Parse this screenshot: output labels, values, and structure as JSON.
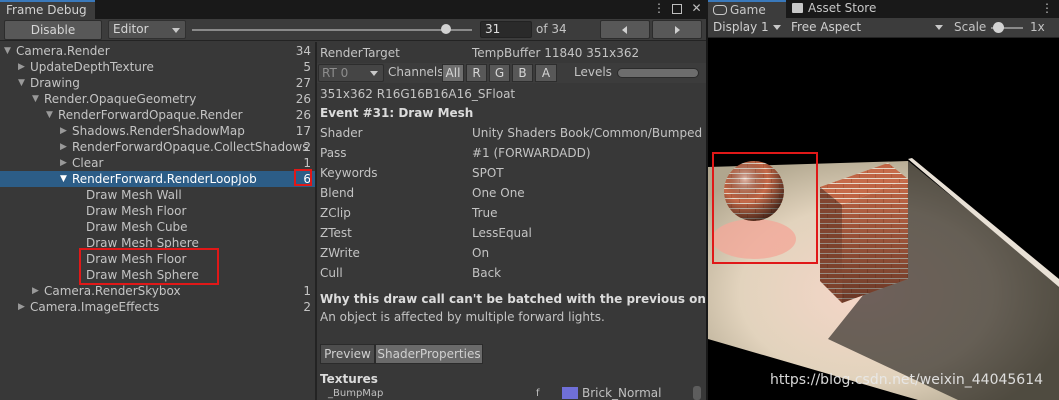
{
  "frame_debug": {
    "tab_title": "Frame Debug",
    "disable_label": "Disable",
    "source_select": "Editor",
    "event_number": "31",
    "event_total": "of 34",
    "event_progress": 31
  },
  "tree": [
    {
      "label": "Camera.Render",
      "count": "34",
      "arrow": "▼"
    },
    {
      "label": "UpdateDepthTexture",
      "count": "5",
      "arrow": "▶"
    },
    {
      "label": "Drawing",
      "count": "27",
      "arrow": "▼"
    },
    {
      "label": "Render.OpaqueGeometry",
      "count": "26",
      "arrow": "▼"
    },
    {
      "label": "RenderForwardOpaque.Render",
      "count": "26",
      "arrow": "▼"
    },
    {
      "label": "Shadows.RenderShadowMap",
      "count": "17",
      "arrow": "▶"
    },
    {
      "label": "RenderForwardOpaque.CollectShadows",
      "count": "2",
      "arrow": "▶"
    },
    {
      "label": "Clear",
      "count": "1",
      "arrow": "▶"
    },
    {
      "label": "RenderForward.RenderLoopJob",
      "count": "6",
      "arrow": "▼"
    },
    {
      "label": "Draw Mesh Wall",
      "count": "",
      "arrow": ""
    },
    {
      "label": "Draw Mesh Floor",
      "count": "",
      "arrow": ""
    },
    {
      "label": "Draw Mesh Cube",
      "count": "",
      "arrow": ""
    },
    {
      "label": "Draw Mesh Sphere",
      "count": "",
      "arrow": ""
    },
    {
      "label": "Draw Mesh Floor",
      "count": "",
      "arrow": ""
    },
    {
      "label": "Draw Mesh Sphere",
      "count": "",
      "arrow": ""
    },
    {
      "label": "Camera.RenderSkybox",
      "count": "1",
      "arrow": "▶"
    },
    {
      "label": "Camera.ImageEffects",
      "count": "2",
      "arrow": "▶"
    }
  ],
  "detail": {
    "render_target_label": "RenderTarget",
    "render_target_value": "TempBuffer 11840 351x362",
    "rt_select": "RT 0",
    "channels_label": "Channels",
    "channels": [
      "All",
      "R",
      "G",
      "B",
      "A"
    ],
    "levels_label": "Levels",
    "format": "351x362 R16G16B16A16_SFloat",
    "event_title": "Event #31: Draw Mesh",
    "props": [
      {
        "k": "Shader",
        "v": "Unity Shaders Book/Common/Bumped Sp"
      },
      {
        "k": "Pass",
        "v": "#1 (FORWARDADD)"
      },
      {
        "k": "Keywords",
        "v": "SPOT"
      },
      {
        "k": "Blend",
        "v": "One One"
      },
      {
        "k": "ZClip",
        "v": "True"
      },
      {
        "k": "ZTest",
        "v": "LessEqual"
      },
      {
        "k": "ZWrite",
        "v": "On"
      },
      {
        "k": "Cull",
        "v": "Back"
      }
    ],
    "batch_title": "Why this draw call can't be batched with the previous one",
    "batch_reason": "An object is affected by multiple forward lights.",
    "subtabs": [
      "Preview",
      "ShaderProperties"
    ],
    "textures_heading": "Textures",
    "texture_name": "_BumpMap",
    "texture_stage": "f",
    "texture_value": "Brick_Normal"
  },
  "game": {
    "tab_game": "Game",
    "tab_store": "Asset Store",
    "display": "Display 1",
    "aspect": "Free Aspect",
    "scale_label": "Scale",
    "scale_value": "1x"
  },
  "watermark": "https://blog.csdn.net/weixin_44045614",
  "colors": {
    "selection": "#2c5d87",
    "highlight_box": "#e01818",
    "tab_accent": "#3a79bb"
  }
}
